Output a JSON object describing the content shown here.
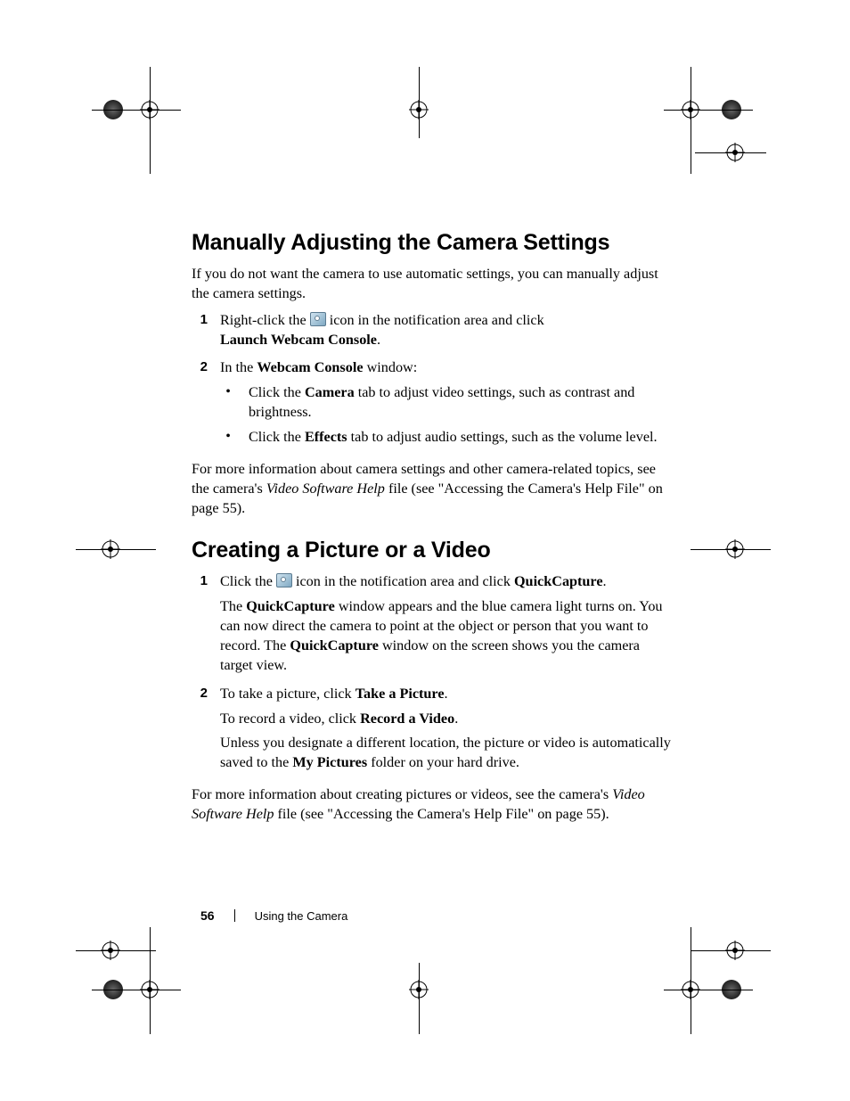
{
  "footer": {
    "page_number": "56",
    "section": "Using the Camera"
  },
  "section1": {
    "heading": "Manually Adjusting the Camera Settings",
    "intro": "If you do not want the camera to use automatic settings, you can manually adjust the camera settings.",
    "step1_num": "1",
    "step1_a": "Right-click the ",
    "step1_b": " icon in the notification area and click ",
    "step1_bold": "Launch Webcam Console",
    "step1_end": ".",
    "step2_num": "2",
    "step2_a": "In the ",
    "step2_bold": "Webcam Console",
    "step2_b": " window:",
    "bullet1_a": "Click the ",
    "bullet1_bold": "Camera",
    "bullet1_b": " tab to adjust video settings, such as contrast and brightness.",
    "bullet2_a": "Click the ",
    "bullet2_bold": "Effects",
    "bullet2_b": " tab to adjust audio settings, such as the volume level.",
    "more_a": "For more information about camera settings and other camera-related topics, see the camera's ",
    "more_italic": "Video Software Help",
    "more_b": " file (see \"Accessing the Camera's Help File\" on page 55)."
  },
  "section2": {
    "heading": "Creating a Picture or a Video",
    "step1_num": "1",
    "step1_a": "Click the ",
    "step1_b": " icon in the notification area and click ",
    "step1_bold": "QuickCapture",
    "step1_end": ".",
    "step1_p2_a": "The ",
    "step1_p2_bold1": "QuickCapture",
    "step1_p2_b": " window appears and the blue camera light turns on. You can now direct the camera to point at the object or person that you want to record. The ",
    "step1_p2_bold2": "QuickCapture",
    "step1_p2_c": " window on the screen shows you the camera target view.",
    "step2_num": "2",
    "step2_a": "To take a picture, click ",
    "step2_bold": "Take a Picture",
    "step2_end": ".",
    "step2_p2_a": "To record a video, click ",
    "step2_p2_bold": "Record a Video",
    "step2_p2_end": ".",
    "step2_p3_a": "Unless you designate a different location, the picture or video is automatically saved to the ",
    "step2_p3_bold": "My Pictures",
    "step2_p3_b": " folder on your hard drive.",
    "more_a": "For more information about creating pictures or videos, see the camera's ",
    "more_italic": "Video Software Help",
    "more_b": " file (see \"Accessing the Camera's Help File\" on page 55)."
  }
}
